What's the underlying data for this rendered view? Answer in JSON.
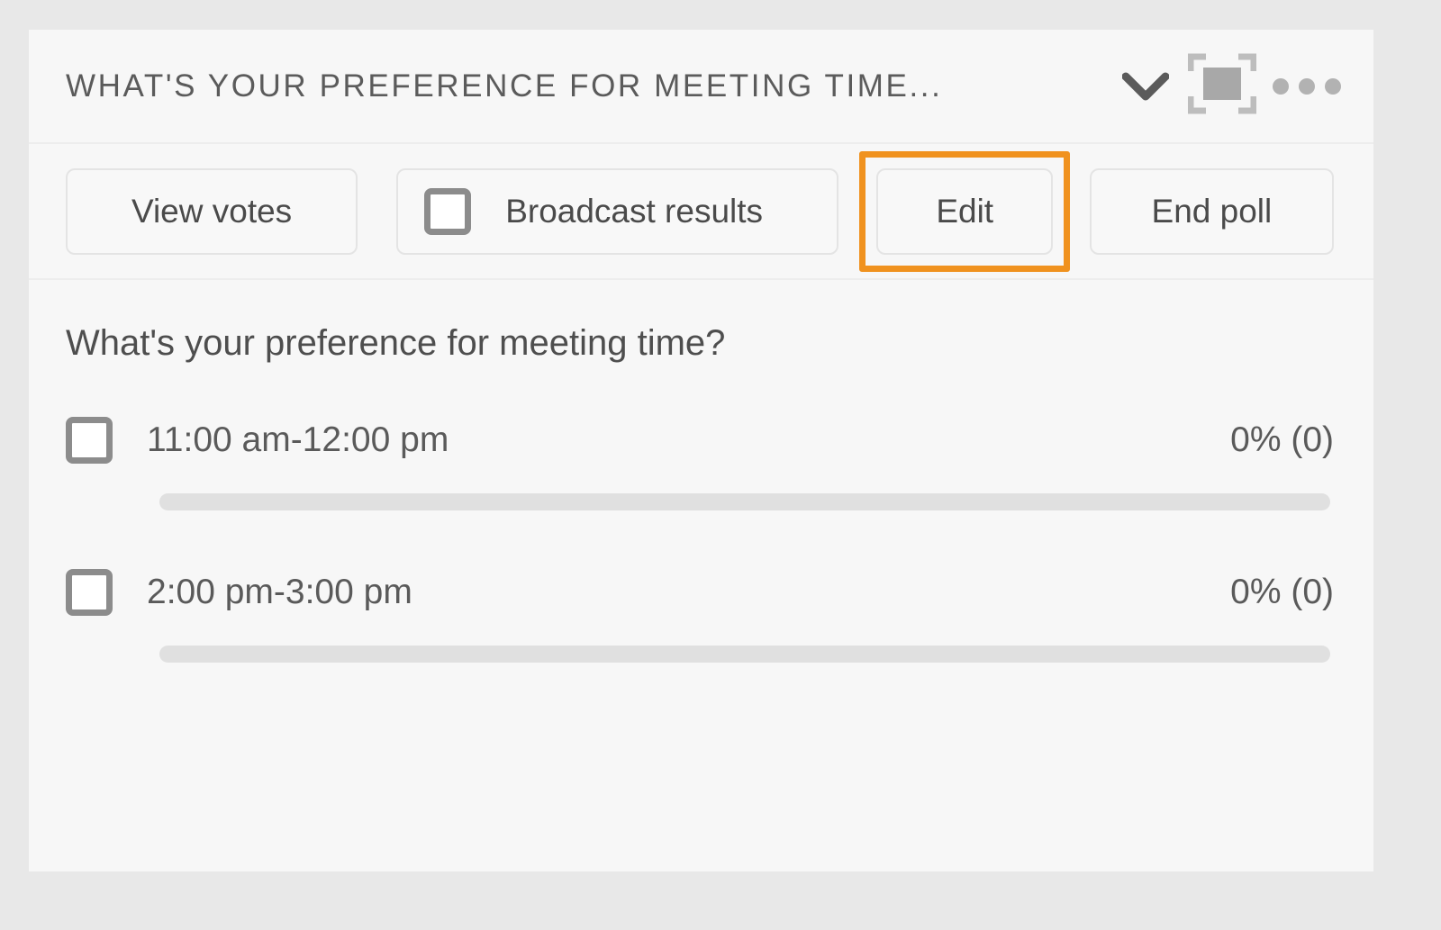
{
  "panel": {
    "header": {
      "title": "WHAT'S YOUR PREFERENCE FOR MEETING TIME...",
      "collapse_icon": "chevron-down-icon",
      "maximize_icon": "maximize-icon",
      "overflow_icon": "more-options-icon"
    },
    "toolbar": {
      "view_votes_label": "View votes",
      "broadcast_label": "Broadcast results",
      "broadcast_checkbox_checked": false,
      "edit_label": "Edit",
      "end_poll_label": "End poll",
      "highlighted_button": "Edit",
      "highlight_color": "#f0921f"
    },
    "poll": {
      "question": "What's your preference for meeting time?",
      "options": [
        {
          "label": "11:00 am-12:00 pm",
          "result": "0% (0)",
          "percent": 0,
          "votes": 0,
          "checked": false
        },
        {
          "label": "2:00 pm-3:00 pm",
          "result": "0% (0)",
          "percent": 0,
          "votes": 0,
          "checked": false
        }
      ]
    }
  }
}
